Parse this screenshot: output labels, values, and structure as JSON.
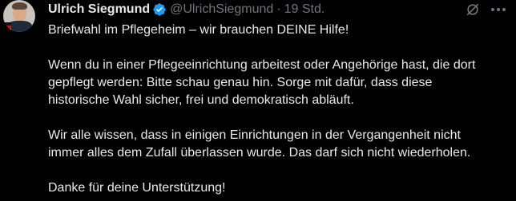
{
  "tweet": {
    "author_name": "Ulrich Siegmund",
    "handle": "@UlrichSiegmund",
    "separator": "·",
    "time": "19 Std.",
    "lines": [
      "Briefwahl im Pflegeheim – wir brauchen DEINE Hilfe!",
      "Wenn du in einer Pflegeeinrichtung arbeitest oder Angehörige hast, die dort",
      "gepflegt werden: Bitte schau genau hin. Sorge mit dafür, dass diese",
      "historische Wahl sicher, frei und demokratisch abläuft.",
      "Wir alle wissen, dass in einigen Einrichtungen in der Vergangenheit nicht",
      "immer alles dem Zufall überlassen wurde. Das darf sich nicht wiederholen.",
      "Danke für deine Unterstützung!"
    ]
  },
  "icons": {
    "verified": "verified-badge-icon",
    "grok": "grok-icon",
    "more": "more-options-icon"
  },
  "colors": {
    "background": "#000000",
    "text": "#e7e9ea",
    "secondary_text": "#71767b",
    "verified_blue": "#1d9bf0"
  }
}
